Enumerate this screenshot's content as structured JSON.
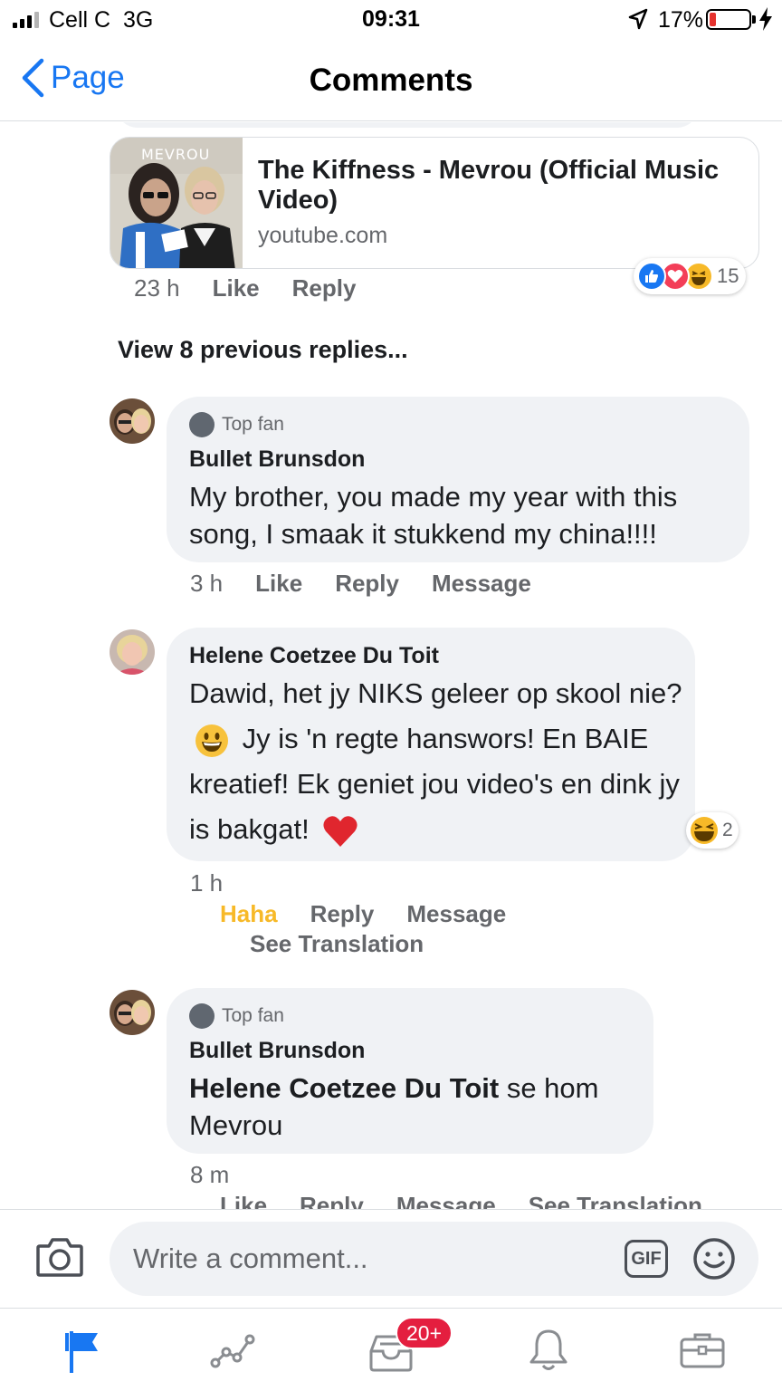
{
  "status_bar": {
    "carrier": "Cell C",
    "network": "3G",
    "time": "09:31",
    "battery_percent": "17%",
    "battery_level": 0.17,
    "battery_color": "#e5322e"
  },
  "nav": {
    "back_label": "Page",
    "title": "Comments"
  },
  "link_preview": {
    "thumbnail_text": "MEVROU",
    "title": "The Kiffness - Mevrou (Official Music Video)",
    "domain": "youtube.com",
    "reactions": [
      "like",
      "love",
      "haha"
    ],
    "reaction_count": "15",
    "time": "23 h",
    "like_label": "Like",
    "reply_label": "Reply"
  },
  "view_previous": "View 8 previous replies...",
  "comments": [
    {
      "badge": "Top fan",
      "author": "Bullet Brunsdon",
      "text": "My brother, you made my year with this song, I smaak it stukkend my china!!!!",
      "time": "3 h",
      "actions": [
        "Like",
        "Reply",
        "Message"
      ]
    },
    {
      "author": "Helene Coetzee Du Toit",
      "text_part1": "Dawid, het jy NIKS geleer op skool nie?",
      "text_part2": "Jy is 'n regte hanswors! En BAIE kreatief! Ek geniet jou video's en dink jy is bakgat!",
      "emojis": [
        "grinning-face",
        "red-heart"
      ],
      "reaction": "haha",
      "reaction_count": "2",
      "time": "1 h",
      "actions": [
        "Haha",
        "Reply",
        "Message"
      ],
      "translation": "See Translation",
      "haha_color": "#f7b928"
    },
    {
      "badge": "Top fan",
      "author": "Bullet Brunsdon",
      "mention": "Helene Coetzee Du Toit",
      "text": "se hom Mevrou",
      "time": "8 m",
      "actions": [
        "Like",
        "Reply",
        "Message",
        "See Translation"
      ]
    }
  ],
  "composer": {
    "placeholder": "Write a comment...",
    "gif_label": "GIF"
  },
  "tab_bar": {
    "tabs": [
      "pages-flag-icon",
      "insights-icon",
      "inbox-icon",
      "notifications-bell-icon",
      "tools-briefcase-icon"
    ],
    "active": "pages-flag-icon",
    "inbox_badge": "20+",
    "accent_color": "#1877f2"
  }
}
